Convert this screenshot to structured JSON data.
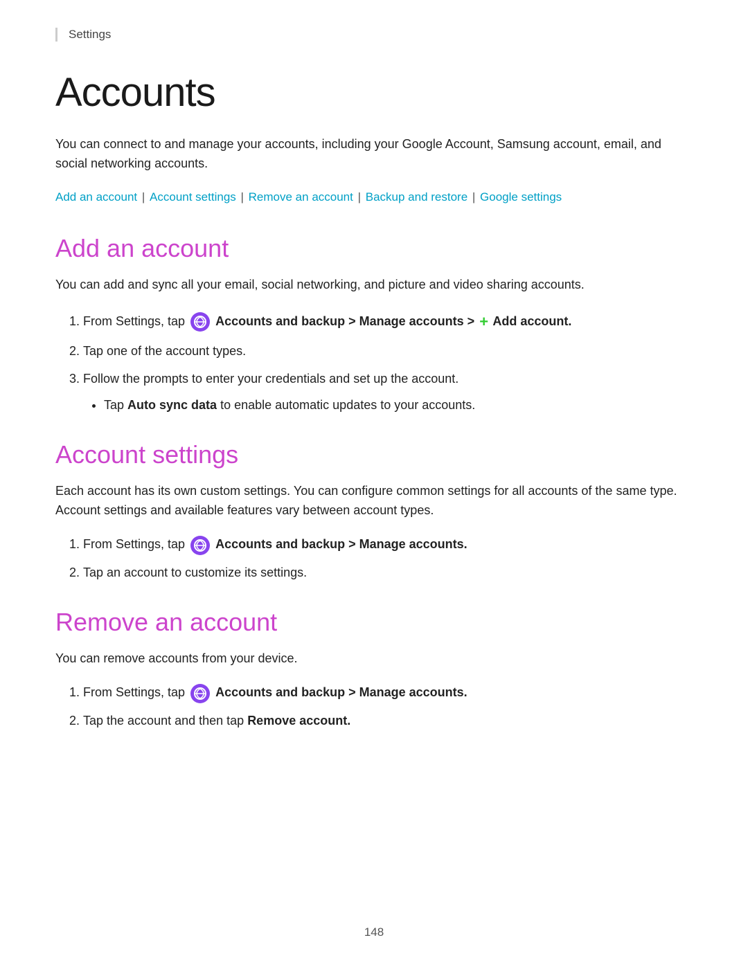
{
  "breadcrumb": "Settings",
  "page_title": "Accounts",
  "intro": {
    "text": "You can connect to and manage your accounts, including your Google Account, Samsung account, email, and social networking accounts."
  },
  "nav_links": {
    "add_account": "Add an account",
    "account_settings": "Account settings",
    "remove_account": "Remove an account",
    "backup_restore": "Backup and restore",
    "google_settings": "Google settings"
  },
  "sections": {
    "add_account": {
      "title": "Add an account",
      "intro": "You can add and sync all your email, social networking, and picture and video sharing accounts.",
      "steps": [
        {
          "text_before": "From Settings, tap",
          "bold": "Accounts and backup > Manage accounts >",
          "add_icon": "+ Add account.",
          "text_after": ""
        },
        {
          "text": "Tap one of the account types."
        },
        {
          "text": "Follow the prompts to enter your credentials and set up the account.",
          "bullet": "Tap Auto sync data to enable automatic updates to your accounts."
        }
      ]
    },
    "account_settings": {
      "title": "Account settings",
      "intro": "Each account has its own custom settings. You can configure common settings for all accounts of the same type. Account settings and available features vary between account types.",
      "steps": [
        {
          "text_before": "From Settings, tap",
          "bold": "Accounts and backup > Manage accounts."
        },
        {
          "text": "Tap an account to customize its settings."
        }
      ]
    },
    "remove_account": {
      "title": "Remove an account",
      "intro": "You can remove accounts from your device.",
      "steps": [
        {
          "text_before": "From Settings, tap",
          "bold": "Accounts and backup > Manage accounts."
        },
        {
          "text_before": "Tap the account and then tap",
          "bold": "Remove account."
        }
      ]
    }
  },
  "footer": {
    "page_number": "148"
  }
}
